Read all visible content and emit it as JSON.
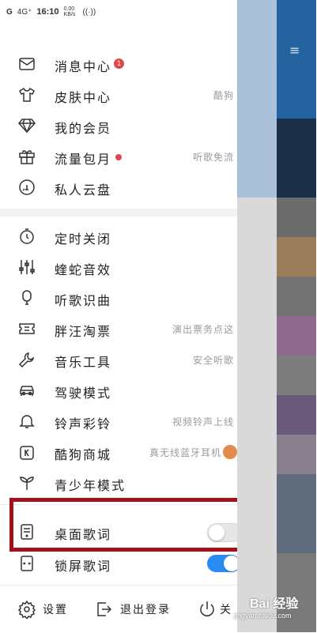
{
  "status_bar": {
    "signal": "G",
    "network": "4G⁺",
    "time": "16:10",
    "speed": "0.00 KB/s"
  },
  "menu_group_1": [
    {
      "label": "消息中心",
      "icon": "envelope-icon",
      "badge": "1",
      "sub": ""
    },
    {
      "label": "皮肤中心",
      "icon": "shirt-icon",
      "sub": "酷狗"
    },
    {
      "label": "我的会员",
      "icon": "diamond-icon",
      "sub": ""
    },
    {
      "label": "流量包月",
      "icon": "gift-icon",
      "dot": true,
      "sub": "听歌免流"
    },
    {
      "label": "私人云盘",
      "icon": "cloud-icon",
      "sub": ""
    }
  ],
  "menu_group_2": [
    {
      "label": "定时关闭",
      "icon": "timer-icon",
      "sub": ""
    },
    {
      "label": "蝰蛇音效",
      "icon": "equalizer-icon",
      "sub": ""
    },
    {
      "label": "听歌识曲",
      "icon": "microphone-icon",
      "sub": ""
    },
    {
      "label": "胖汪淘票",
      "icon": "ticket-icon",
      "sub": "演出票务点这"
    },
    {
      "label": "音乐工具",
      "icon": "wrench-icon",
      "sub": "安全听歌"
    },
    {
      "label": "驾驶模式",
      "icon": "car-icon",
      "sub": ""
    },
    {
      "label": "铃声彩铃",
      "icon": "bell-icon",
      "sub": "视频铃声上线"
    },
    {
      "label": "酷狗商城",
      "icon": "store-icon",
      "sub": "真无线蓝牙耳机"
    },
    {
      "label": "青少年模式",
      "icon": "sprout-icon",
      "sub": ""
    }
  ],
  "lyrics": {
    "desktop": {
      "label": "桌面歌词",
      "icon": "desktop-lyrics-icon",
      "enabled": false
    },
    "lockscreen": {
      "label": "锁屏歌词",
      "icon": "lockscreen-lyrics-icon",
      "enabled": true
    }
  },
  "bottom_bar": {
    "settings": "设置",
    "logout": "退出登录",
    "exit": "关"
  },
  "watermark": {
    "brand": "Bai 经验",
    "url": "jingyan.baidu.com"
  },
  "colors": {
    "badge": "#e0474b",
    "toggle_on": "#2a8cf2",
    "highlight_box": "#a3111b"
  }
}
